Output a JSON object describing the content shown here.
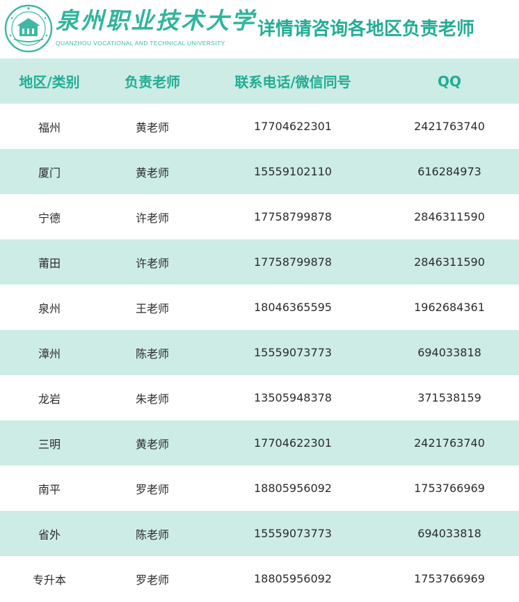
{
  "header": {
    "brand_cn": "泉州职业技术大学",
    "brand_en": "QUANZHOU VOCATIONAL AND TECHNICAL UNIVERSITY",
    "notice": "详情请咨询各地区负责老师"
  },
  "table": {
    "columns": [
      "地区/类别",
      "负责老师",
      "联系电话/微信同号",
      "QQ"
    ],
    "rows": [
      [
        "福州",
        "黄老师",
        "17704622301",
        "2421763740"
      ],
      [
        "厦门",
        "黄老师",
        "15559102110",
        "616284973"
      ],
      [
        "宁德",
        "许老师",
        "17758799878",
        "2846311590"
      ],
      [
        "莆田",
        "许老师",
        "17758799878",
        "2846311590"
      ],
      [
        "泉州",
        "王老师",
        "18046365595",
        "1962684361"
      ],
      [
        "漳州",
        "陈老师",
        "15559073773",
        "694033818"
      ],
      [
        "龙岩",
        "朱老师",
        "13505948378",
        "371538159"
      ],
      [
        "三明",
        "黄老师",
        "17704622301",
        "2421763740"
      ],
      [
        "南平",
        "罗老师",
        "18805956092",
        "1753766969"
      ],
      [
        "省外",
        "陈老师",
        "15559073773",
        "694033818"
      ],
      [
        "专升本",
        "罗老师",
        "18805956092",
        "1753766969"
      ]
    ]
  },
  "colors": {
    "accent": "#22ad93",
    "row_alt": "#cdece6",
    "text": "#2b2b2b"
  }
}
